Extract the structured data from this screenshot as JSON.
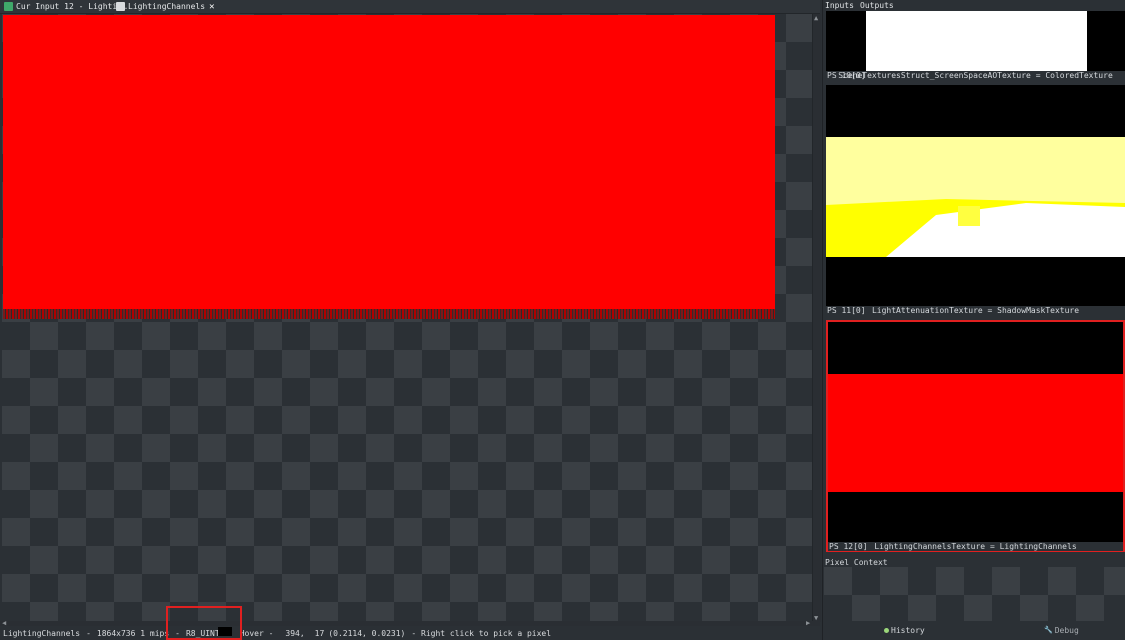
{
  "tabs": [
    {
      "label": "Cur Input 12 - Lightin…",
      "active": false
    },
    {
      "label": "LightingChannels",
      "active": true
    }
  ],
  "status_bar": {
    "texture_name": "LightingChannels",
    "dimensions": "1864x736 1 mips",
    "format": "R8_UINT",
    "hover_label": "Hover -",
    "hover_coords": "394,",
    "hover_coords_y": "17",
    "hover_uv": "(0.2114, 0.0231)",
    "hint": "- Right click to pick a pixel"
  },
  "right_panel": {
    "tabs": {
      "inputs": "Inputs",
      "outputs": "Outputs"
    },
    "thumbnails": [
      {
        "slot": "PS 10[0]",
        "label": "SceneTexturesStruct_ScreenSpaceAOTexture = ColoredTexture"
      },
      {
        "slot": "PS 11[0]",
        "label": "LightAttenuationTexture = ShadowMaskTexture"
      },
      {
        "slot": "PS 12[0]",
        "label": "LightingChannelsTexture = LightingChannels"
      }
    ],
    "pixel_context_title": "Pixel Context",
    "bottom_tabs": {
      "history": "History",
      "debug": "Debug"
    }
  },
  "colors": {
    "accent_red": "#ff0000",
    "highlight": "#e02020",
    "background": "#2b3035"
  }
}
